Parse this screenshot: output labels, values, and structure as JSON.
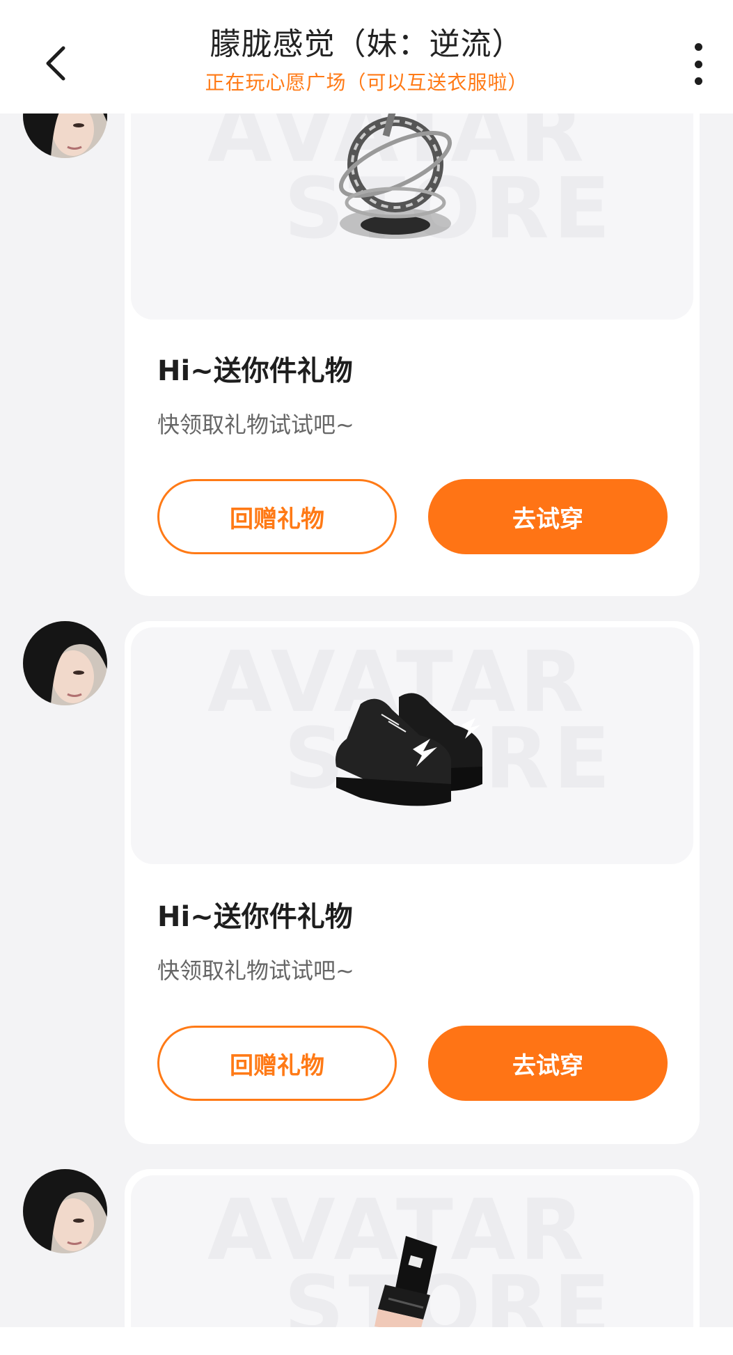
{
  "header": {
    "title": "朦胧感觉（妹：逆流）",
    "subtitle": "正在玩心愿广场（可以互送衣服啦）",
    "back_icon": "chevron-left-icon",
    "more_icon": "vertical-dots-icon"
  },
  "messages": [
    {
      "item": "ring-accessory",
      "title": "Hi~送你件礼物",
      "subtitle": "快领取礼物试试吧~",
      "return_gift_label": "回赠礼物",
      "try_on_label": "去试穿"
    },
    {
      "item": "black-sneakers",
      "title": "Hi~送你件礼物",
      "subtitle": "快领取礼物试试吧~",
      "return_gift_label": "回赠礼物",
      "try_on_label": "去试穿"
    },
    {
      "item": "black-glove"
    }
  ],
  "watermark": {
    "line1": "AVATAR",
    "line2": "STORE"
  },
  "colors": {
    "accent": "#ff7415",
    "background": "#f3f3f5",
    "card": "#ffffff"
  }
}
